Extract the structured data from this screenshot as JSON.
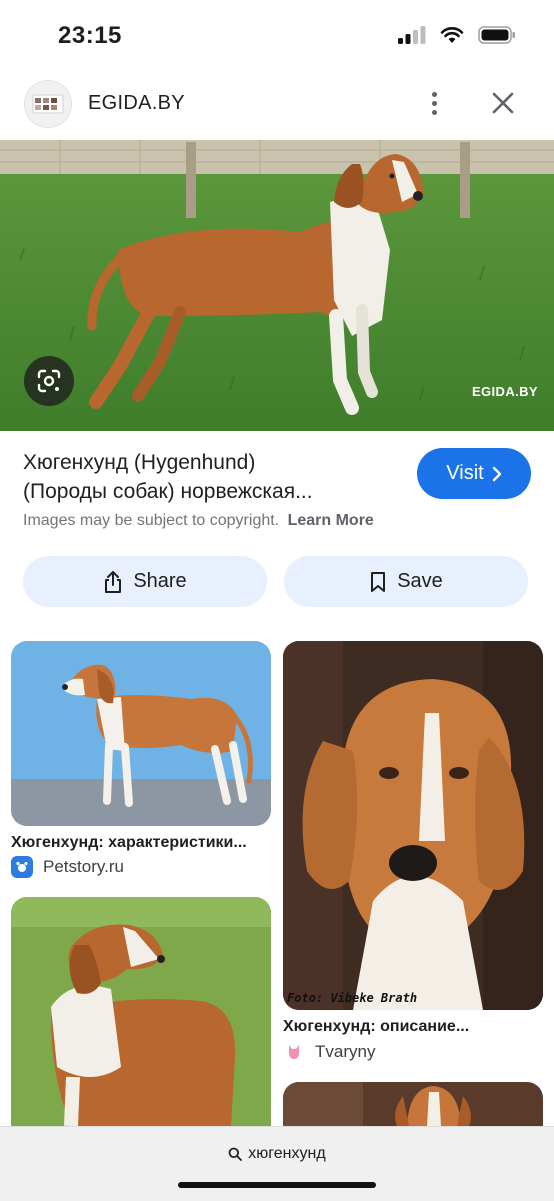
{
  "status_bar": {
    "time": "23:15"
  },
  "header": {
    "site_name": "EGIDA.BY"
  },
  "hero": {
    "watermark": "EGIDA.BY"
  },
  "result": {
    "title_line1": "Хюгенхунд (Hygenhund)",
    "title_line2": "(Породы собак) норвежская...",
    "visit_label": "Visit",
    "copyright_text": "Images may be subject to copyright.",
    "learn_more_label": "Learn More",
    "share_label": "Share",
    "save_label": "Save"
  },
  "related": [
    {
      "caption": "Хюгенхунд: характеристики...",
      "source": "Petstory.ru",
      "source_icon": "petstory-icon"
    },
    {
      "caption": "Хюгенхунд: описание...",
      "source": "Tvaryny",
      "source_icon": "tvaryny-icon",
      "image_text": "Foto: Vibeke Brath"
    }
  ],
  "bottom_bar": {
    "query": "хюгенхунд"
  },
  "colors": {
    "accent": "#1a73e8",
    "pill": "#e8f0fe",
    "muted": "#70757a"
  }
}
